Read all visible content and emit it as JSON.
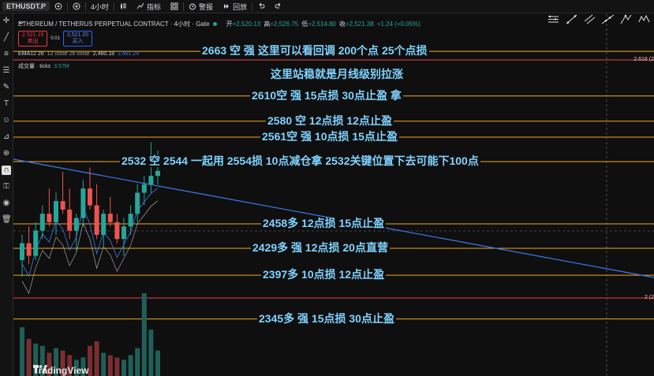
{
  "toolbar": {
    "symbol": "ETHUSDT.P",
    "interval": "4小时",
    "indicators": "指标",
    "alert": "警报",
    "replay": "回放"
  },
  "legend": {
    "title": "ETHEREUM / TETHERUS PERPETUAL CONTRACT · 4小时 · Gate",
    "open_label": "开",
    "open": "=2,520.13",
    "high_label": "高",
    "high": "=2,526.75",
    "low_label": "低",
    "low": "=2,514.80",
    "close_label": "收",
    "close": "=2,521.38",
    "change": "+1.24 (+0.05%)",
    "sell_price": "2,521.19",
    "sell_label": "卖出",
    "spread": "0.01",
    "buy_price": "2,521.20",
    "buy_label": "买入",
    "ema_label": "EMA12 26",
    "ema_params": "12 close 26 close",
    "ema_value1": "2,460.18",
    "ema_value2": "2,491.24",
    "volume_label": "成交量 · ticks",
    "volume_value": "3.57M"
  },
  "axis_labels": {
    "upper": "2.618 (2",
    "lower": "2 (2"
  },
  "annotations": [
    {
      "price": 2663,
      "text": "2663  空    强 这里可以看回调 200个点   25个点损"
    },
    {
      "price": 2650,
      "text": "这里站稳就是月线级别拉涨"
    },
    {
      "price": 2610,
      "text": "2610空 强   15点损    30点止盈 拿"
    },
    {
      "price": 2580,
      "text": "2580 空     12点损 12点止盈"
    },
    {
      "price": 2561,
      "text": "2561空 强   10点损    15点止盈"
    },
    {
      "price": 2532,
      "text": "2532 空     2544 一起用    2554损       10点减仓拿    2532关键位置下去可能下100点"
    },
    {
      "price": 2458,
      "text": "2458多      12点损      15点止盈"
    },
    {
      "price": 2429,
      "text": "2429多 强         12点损      20点直营"
    },
    {
      "price": 2397,
      "text": "2397多      10点损      12点止盈"
    },
    {
      "price": 2345,
      "text": "2345多  强  15点损      30点止盈"
    }
  ],
  "colors": {
    "level_line": "#f5a623",
    "red_line": "#e0464c",
    "trend_line": "#3d7cf0",
    "annotation_text": "#7fd3ff",
    "bull": "#26a69a",
    "bear": "#ef5350"
  },
  "candles": [
    {
      "o": 2415,
      "h": 2445,
      "l": 2395,
      "c": 2435
    },
    {
      "o": 2435,
      "h": 2455,
      "l": 2410,
      "c": 2420
    },
    {
      "o": 2420,
      "h": 2460,
      "l": 2415,
      "c": 2450
    },
    {
      "o": 2450,
      "h": 2480,
      "l": 2440,
      "c": 2470
    },
    {
      "o": 2470,
      "h": 2500,
      "l": 2455,
      "c": 2460
    },
    {
      "o": 2460,
      "h": 2495,
      "l": 2445,
      "c": 2485
    },
    {
      "o": 2485,
      "h": 2520,
      "l": 2470,
      "c": 2475
    },
    {
      "o": 2475,
      "h": 2500,
      "l": 2440,
      "c": 2450
    },
    {
      "o": 2450,
      "h": 2470,
      "l": 2425,
      "c": 2465
    },
    {
      "o": 2465,
      "h": 2510,
      "l": 2455,
      "c": 2500
    },
    {
      "o": 2500,
      "h": 2525,
      "l": 2475,
      "c": 2480
    },
    {
      "o": 2480,
      "h": 2505,
      "l": 2440,
      "c": 2445
    },
    {
      "o": 2445,
      "h": 2475,
      "l": 2430,
      "c": 2470
    },
    {
      "o": 2470,
      "h": 2490,
      "l": 2455,
      "c": 2460
    },
    {
      "o": 2460,
      "h": 2470,
      "l": 2435,
      "c": 2440
    },
    {
      "o": 2440,
      "h": 2465,
      "l": 2420,
      "c": 2455
    },
    {
      "o": 2455,
      "h": 2480,
      "l": 2445,
      "c": 2470
    },
    {
      "o": 2470,
      "h": 2505,
      "l": 2460,
      "c": 2495
    },
    {
      "o": 2495,
      "h": 2515,
      "l": 2480,
      "c": 2505
    },
    {
      "o": 2505,
      "h": 2555,
      "l": 2495,
      "c": 2515
    },
    {
      "o": 2515,
      "h": 2545,
      "l": 2505,
      "c": 2521
    }
  ],
  "volumes": [
    2.1,
    1.6,
    1.4,
    1.3,
    1.0,
    1.2,
    1.1,
    0.9,
    0.7,
    0.8,
    1.3,
    1.5,
    1.0,
    0.9,
    0.8,
    0.7,
    0.9,
    1.2,
    3.57,
    2.0,
    1.1
  ]
}
